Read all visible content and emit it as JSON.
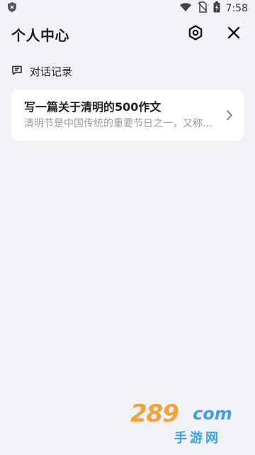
{
  "status_bar": {
    "time": "7:58",
    "icons": [
      "shield-icon",
      "wifi-icon",
      "no-sim-icon",
      "battery-charging-icon"
    ]
  },
  "header": {
    "title": "个人中心",
    "settings_icon": "settings-hexagon-icon",
    "close_icon": "close-icon"
  },
  "history": {
    "section_label": "对话记录",
    "section_icon": "chat-bubble-icon",
    "items": [
      {
        "title": "写一篇关于清明的500作文",
        "preview": "清明节是中国传统的重要节日之一，又称…"
      }
    ]
  },
  "watermark": {
    "logo": "289",
    "domain": "com",
    "text": "手游网"
  },
  "colors": {
    "background": "#f1f2f6",
    "card": "#ffffff",
    "primary_text": "#222222",
    "secondary_text": "#9a9a9a",
    "watermark_orange": "#f3a23a",
    "watermark_blue": "#3aa3e8"
  }
}
